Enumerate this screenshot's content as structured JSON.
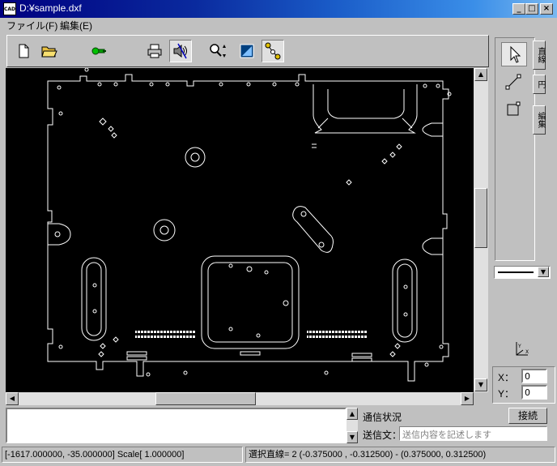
{
  "window": {
    "title": "D:¥sample.dxf",
    "icon_text": "CAD",
    "minimize_glyph": "_",
    "maximize_glyph": "□",
    "close_glyph": "×"
  },
  "menu": [
    {
      "label": "ファイル(F)"
    },
    {
      "label": "編集(E)"
    }
  ],
  "toolbar": {
    "icons": [
      "new-file-icon",
      "open-folder-icon",
      "wrench-icon",
      "print-icon",
      "sound-wave-icon",
      "zoom-icon",
      "fit-view-icon",
      "node-select-icon"
    ]
  },
  "palette": {
    "tabs": [
      "直線",
      "円",
      "編集"
    ],
    "tools": [
      "pointer-icon",
      "line-tool-icon",
      "rect-tool-icon"
    ],
    "line_style_arrow": "▼",
    "coords": {
      "x_label": "X：",
      "x_value": "0",
      "y_label": "Y：",
      "y_value": "0"
    }
  },
  "comm": {
    "status_label": "通信状況",
    "send_label": "送信文：",
    "send_placeholder": "送信内容を記述します",
    "connect_label": "接続"
  },
  "statusbar": {
    "coord_text": "[-1617.000000,   -35.000000] Scale[    1.000000]",
    "selection_text": "選択直線=    2 (-0.375000 , -0.312500) - (0.375000, 0.312500)"
  },
  "scroll": {
    "up": "▲",
    "down": "▼",
    "left": "◀",
    "right": "▶",
    "vertical_thumb_fraction": 0.45,
    "horizontal_thumb_fraction": 0.4
  }
}
